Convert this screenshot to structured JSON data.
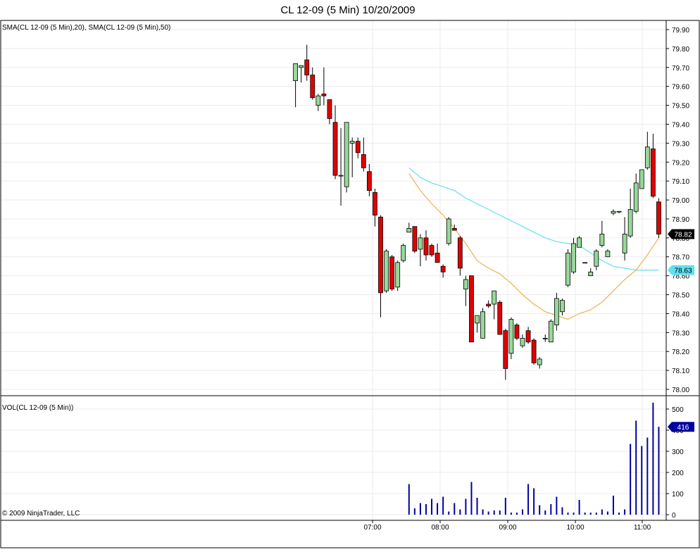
{
  "title": "CL 12-09 (5 Min)  10/20/2009",
  "price_panel": {
    "indicator_label": "SMA(CL 12-09 (5 Min),20), SMA(CL 12-09 (5 Min),50)",
    "ylim": [
      78.0,
      79.9
    ],
    "ticks": [
      "79.90",
      "79.80",
      "79.70",
      "79.60",
      "79.50",
      "79.40",
      "79.30",
      "79.20",
      "79.10",
      "79.00",
      "78.90",
      "78.80",
      "78.70",
      "78.60",
      "78.50",
      "78.40",
      "78.30",
      "78.20",
      "78.10",
      "78.00"
    ],
    "last_price_label": "78.82",
    "sma50_label": "78.63"
  },
  "volume_panel": {
    "label": "VOL(CL 12-09 (5 Min))",
    "ylim": [
      0,
      530
    ],
    "ticks": [
      "500",
      "400",
      "300",
      "200",
      "100",
      "0"
    ],
    "last_volume_label": "416"
  },
  "x_axis": {
    "time_labels": [
      "07:00",
      "08:00",
      "09:00",
      "10:00",
      "11:00"
    ]
  },
  "copyright": "© 2009 NinjaTrader, LLC",
  "colors": {
    "up_candle": "#98d89a",
    "down_candle": "#e00000",
    "sma20": "#f0b050",
    "sma50": "#60e0f0",
    "volume": "#0000a0",
    "last_price_tag": "#000000",
    "sma50_tag": "#60e0f0",
    "volume_tag": "#0000a0"
  },
  "chart_data": [
    {
      "type": "candlestick",
      "title": "CL 12-09 (5 Min)  10/20/2009",
      "series_labels": [
        "SMA(CL 12-09 (5 Min),20)",
        "SMA(CL 12-09 (5 Min),50)"
      ],
      "ylim": [
        78.0,
        79.9
      ],
      "x_labels": [
        "07:00",
        "08:00",
        "09:00",
        "10:00",
        "11:00"
      ],
      "bars": [
        {
          "i": 0,
          "o": 79.63,
          "h": 79.72,
          "l": 79.49,
          "c": 79.72
        },
        {
          "i": 1,
          "o": 79.7,
          "h": 79.71,
          "l": 79.62,
          "c": 79.71
        },
        {
          "i": 2,
          "o": 79.74,
          "h": 79.82,
          "l": 79.63,
          "c": 79.66
        },
        {
          "i": 3,
          "o": 79.66,
          "h": 79.7,
          "l": 79.53,
          "c": 79.54
        },
        {
          "i": 4,
          "o": 79.5,
          "h": 79.56,
          "l": 79.47,
          "c": 79.55
        },
        {
          "i": 5,
          "o": 79.56,
          "h": 79.7,
          "l": 79.5,
          "c": 79.55
        },
        {
          "i": 6,
          "o": 79.53,
          "h": 79.53,
          "l": 79.4,
          "c": 79.43
        },
        {
          "i": 7,
          "o": 79.41,
          "h": 79.5,
          "l": 79.11,
          "c": 79.13
        },
        {
          "i": 8,
          "o": 79.13,
          "h": 79.38,
          "l": 78.97,
          "c": 79.13
        },
        {
          "i": 9,
          "o": 79.07,
          "h": 79.41,
          "l": 79.04,
          "c": 79.41
        },
        {
          "i": 10,
          "o": 79.3,
          "h": 79.33,
          "l": 79.12,
          "c": 79.31
        },
        {
          "i": 11,
          "o": 79.31,
          "h": 79.33,
          "l": 79.22,
          "c": 79.25
        },
        {
          "i": 12,
          "o": 79.24,
          "h": 79.33,
          "l": 79.15,
          "c": 79.17
        },
        {
          "i": 13,
          "o": 79.15,
          "h": 79.19,
          "l": 79.02,
          "c": 79.05
        },
        {
          "i": 14,
          "o": 79.04,
          "h": 79.06,
          "l": 78.86,
          "c": 78.92
        },
        {
          "i": 15,
          "o": 78.91,
          "h": 78.92,
          "l": 78.38,
          "c": 78.51
        },
        {
          "i": 16,
          "o": 78.52,
          "h": 78.74,
          "l": 78.51,
          "c": 78.73
        },
        {
          "i": 17,
          "o": 78.7,
          "h": 78.71,
          "l": 78.52,
          "c": 78.53
        },
        {
          "i": 18,
          "o": 78.54,
          "h": 78.68,
          "l": 78.52,
          "c": 78.67
        },
        {
          "i": 19,
          "o": 78.68,
          "h": 78.77,
          "l": 78.67,
          "c": 78.76
        },
        {
          "i": 20,
          "o": 78.83,
          "h": 78.88,
          "l": 78.83,
          "c": 78.85
        },
        {
          "i": 21,
          "o": 78.86,
          "h": 78.86,
          "l": 78.72,
          "c": 78.73
        },
        {
          "i": 22,
          "o": 78.74,
          "h": 78.82,
          "l": 78.65,
          "c": 78.8
        },
        {
          "i": 23,
          "o": 78.8,
          "h": 78.84,
          "l": 78.68,
          "c": 78.71
        },
        {
          "i": 24,
          "o": 78.76,
          "h": 78.77,
          "l": 78.7,
          "c": 78.71
        },
        {
          "i": 25,
          "o": 78.72,
          "h": 78.77,
          "l": 78.68,
          "c": 78.67
        },
        {
          "i": 26,
          "o": 78.65,
          "h": 78.66,
          "l": 78.59,
          "c": 78.62
        },
        {
          "i": 27,
          "o": 78.77,
          "h": 78.91,
          "l": 78.76,
          "c": 78.9
        },
        {
          "i": 28,
          "o": 78.85,
          "h": 78.87,
          "l": 78.84,
          "c": 78.84
        },
        {
          "i": 29,
          "o": 78.8,
          "h": 78.81,
          "l": 78.6,
          "c": 78.64
        },
        {
          "i": 30,
          "o": 78.53,
          "h": 78.6,
          "l": 78.44,
          "c": 78.58
        },
        {
          "i": 31,
          "o": 78.6,
          "h": 78.6,
          "l": 78.25,
          "c": 78.25
        },
        {
          "i": 32,
          "o": 78.35,
          "h": 78.39,
          "l": 78.3,
          "c": 78.39
        },
        {
          "i": 33,
          "o": 78.27,
          "h": 78.43,
          "l": 78.27,
          "c": 78.41
        },
        {
          "i": 34,
          "o": 78.45,
          "h": 78.47,
          "l": 78.43,
          "c": 78.44
        },
        {
          "i": 35,
          "o": 78.45,
          "h": 78.52,
          "l": 78.37,
          "c": 78.52
        },
        {
          "i": 36,
          "o": 78.46,
          "h": 78.47,
          "l": 78.29,
          "c": 78.29
        },
        {
          "i": 37,
          "o": 78.31,
          "h": 78.32,
          "l": 78.05,
          "c": 78.11
        },
        {
          "i": 38,
          "o": 78.19,
          "h": 78.38,
          "l": 78.16,
          "c": 78.37
        },
        {
          "i": 39,
          "o": 78.34,
          "h": 78.35,
          "l": 78.26,
          "c": 78.27
        },
        {
          "i": 40,
          "o": 78.23,
          "h": 78.29,
          "l": 78.22,
          "c": 78.27
        },
        {
          "i": 41,
          "o": 78.31,
          "h": 78.33,
          "l": 78.24,
          "c": 78.25
        },
        {
          "i": 42,
          "o": 78.26,
          "h": 78.27,
          "l": 78.13,
          "c": 78.14
        },
        {
          "i": 43,
          "o": 78.13,
          "h": 78.17,
          "l": 78.11,
          "c": 78.16
        },
        {
          "i": 44,
          "o": 78.27,
          "h": 78.29,
          "l": 78.25,
          "c": 78.27
        },
        {
          "i": 45,
          "o": 78.25,
          "h": 78.37,
          "l": 78.25,
          "c": 78.36
        },
        {
          "i": 46,
          "o": 78.34,
          "h": 78.51,
          "l": 78.31,
          "c": 78.48
        },
        {
          "i": 47,
          "o": 78.41,
          "h": 78.48,
          "l": 78.39,
          "c": 78.47
        },
        {
          "i": 48,
          "o": 78.55,
          "h": 78.74,
          "l": 78.54,
          "c": 78.72
        },
        {
          "i": 49,
          "o": 78.62,
          "h": 78.8,
          "l": 78.61,
          "c": 78.77
        },
        {
          "i": 50,
          "o": 78.75,
          "h": 78.81,
          "l": 78.75,
          "c": 78.8
        },
        {
          "i": 51,
          "o": 78.67,
          "h": 78.67,
          "l": 78.67,
          "c": 78.67
        },
        {
          "i": 52,
          "o": 78.6,
          "h": 78.64,
          "l": 78.6,
          "c": 78.62
        },
        {
          "i": 53,
          "o": 78.65,
          "h": 78.74,
          "l": 78.63,
          "c": 78.73
        },
        {
          "i": 54,
          "o": 78.76,
          "h": 78.89,
          "l": 78.75,
          "c": 78.82
        },
        {
          "i": 55,
          "o": 78.7,
          "h": 78.74,
          "l": 78.7,
          "c": 78.73
        },
        {
          "i": 56,
          "o": 78.93,
          "h": 78.95,
          "l": 78.92,
          "c": 78.94
        },
        {
          "i": 57,
          "o": 78.94,
          "h": 78.94,
          "l": 78.93,
          "c": 78.94
        },
        {
          "i": 58,
          "o": 78.72,
          "h": 78.91,
          "l": 78.68,
          "c": 78.82
        },
        {
          "i": 59,
          "o": 78.81,
          "h": 79.06,
          "l": 78.8,
          "c": 78.95
        },
        {
          "i": 60,
          "o": 78.94,
          "h": 79.14,
          "l": 78.93,
          "c": 79.09
        },
        {
          "i": 61,
          "o": 79.06,
          "h": 79.16,
          "l": 79.06,
          "c": 79.16
        },
        {
          "i": 62,
          "o": 79.17,
          "h": 79.36,
          "l": 79.16,
          "c": 79.28
        },
        {
          "i": 63,
          "o": 79.27,
          "h": 79.35,
          "l": 79.01,
          "c": 79.02
        },
        {
          "i": 64,
          "o": 78.99,
          "h": 79.01,
          "l": 78.8,
          "c": 78.82
        }
      ],
      "sma20": [
        {
          "i": 20,
          "v": 79.14
        },
        {
          "i": 22,
          "v": 79.05
        },
        {
          "i": 24,
          "v": 78.98
        },
        {
          "i": 26,
          "v": 78.92
        },
        {
          "i": 28,
          "v": 78.85
        },
        {
          "i": 30,
          "v": 78.77
        },
        {
          "i": 32,
          "v": 78.68
        },
        {
          "i": 34,
          "v": 78.64
        },
        {
          "i": 36,
          "v": 78.61
        },
        {
          "i": 38,
          "v": 78.56
        },
        {
          "i": 40,
          "v": 78.5
        },
        {
          "i": 42,
          "v": 78.45
        },
        {
          "i": 44,
          "v": 78.41
        },
        {
          "i": 46,
          "v": 78.39
        },
        {
          "i": 48,
          "v": 78.37
        },
        {
          "i": 50,
          "v": 78.4
        },
        {
          "i": 52,
          "v": 78.42
        },
        {
          "i": 54,
          "v": 78.46
        },
        {
          "i": 56,
          "v": 78.52
        },
        {
          "i": 58,
          "v": 78.58
        },
        {
          "i": 60,
          "v": 78.63
        },
        {
          "i": 62,
          "v": 78.71
        },
        {
          "i": 64,
          "v": 78.8
        }
      ],
      "sma50": [
        {
          "i": 20,
          "v": 79.17
        },
        {
          "i": 22,
          "v": 79.12
        },
        {
          "i": 24,
          "v": 79.09
        },
        {
          "i": 26,
          "v": 79.07
        },
        {
          "i": 28,
          "v": 79.05
        },
        {
          "i": 30,
          "v": 79.01
        },
        {
          "i": 32,
          "v": 78.98
        },
        {
          "i": 34,
          "v": 78.95
        },
        {
          "i": 36,
          "v": 78.92
        },
        {
          "i": 38,
          "v": 78.89
        },
        {
          "i": 40,
          "v": 78.86
        },
        {
          "i": 42,
          "v": 78.83
        },
        {
          "i": 44,
          "v": 78.8
        },
        {
          "i": 46,
          "v": 78.78
        },
        {
          "i": 48,
          "v": 78.77
        },
        {
          "i": 50,
          "v": 78.76
        },
        {
          "i": 52,
          "v": 78.72
        },
        {
          "i": 54,
          "v": 78.68
        },
        {
          "i": 56,
          "v": 78.65
        },
        {
          "i": 58,
          "v": 78.64
        },
        {
          "i": 60,
          "v": 78.63
        },
        {
          "i": 62,
          "v": 78.63
        },
        {
          "i": 64,
          "v": 78.63
        }
      ],
      "last_price": 78.82,
      "last_sma50": 78.63
    },
    {
      "type": "bar",
      "title": "VOL(CL 12-09 (5 Min))",
      "ylim": [
        0,
        530
      ],
      "volumes": [
        {
          "i": 20,
          "v": 145
        },
        {
          "i": 21,
          "v": 30
        },
        {
          "i": 22,
          "v": 55
        },
        {
          "i": 23,
          "v": 50
        },
        {
          "i": 24,
          "v": 75
        },
        {
          "i": 25,
          "v": 55
        },
        {
          "i": 26,
          "v": 85
        },
        {
          "i": 27,
          "v": 15
        },
        {
          "i": 28,
          "v": 55
        },
        {
          "i": 29,
          "v": 25
        },
        {
          "i": 30,
          "v": 75
        },
        {
          "i": 31,
          "v": 155
        },
        {
          "i": 32,
          "v": 80
        },
        {
          "i": 33,
          "v": 25
        },
        {
          "i": 34,
          "v": 15
        },
        {
          "i": 35,
          "v": 20
        },
        {
          "i": 36,
          "v": 20
        },
        {
          "i": 37,
          "v": 80
        },
        {
          "i": 38,
          "v": 10
        },
        {
          "i": 39,
          "v": 10
        },
        {
          "i": 40,
          "v": 25
        },
        {
          "i": 41,
          "v": 145
        },
        {
          "i": 42,
          "v": 125
        },
        {
          "i": 43,
          "v": 45
        },
        {
          "i": 44,
          "v": 20
        },
        {
          "i": 45,
          "v": 50
        },
        {
          "i": 46,
          "v": 85
        },
        {
          "i": 47,
          "v": 35
        },
        {
          "i": 48,
          "v": 10
        },
        {
          "i": 49,
          "v": 10
        },
        {
          "i": 50,
          "v": 70
        },
        {
          "i": 51,
          "v": 10
        },
        {
          "i": 52,
          "v": 10
        },
        {
          "i": 53,
          "v": 10
        },
        {
          "i": 54,
          "v": 25
        },
        {
          "i": 55,
          "v": 15
        },
        {
          "i": 56,
          "v": 90
        },
        {
          "i": 57,
          "v": 10
        },
        {
          "i": 58,
          "v": 25
        },
        {
          "i": 59,
          "v": 335
        },
        {
          "i": 60,
          "v": 445
        },
        {
          "i": 61,
          "v": 325
        },
        {
          "i": 62,
          "v": 365
        },
        {
          "i": 63,
          "v": 530
        },
        {
          "i": 64,
          "v": 416
        }
      ],
      "last_volume": 416
    }
  ]
}
